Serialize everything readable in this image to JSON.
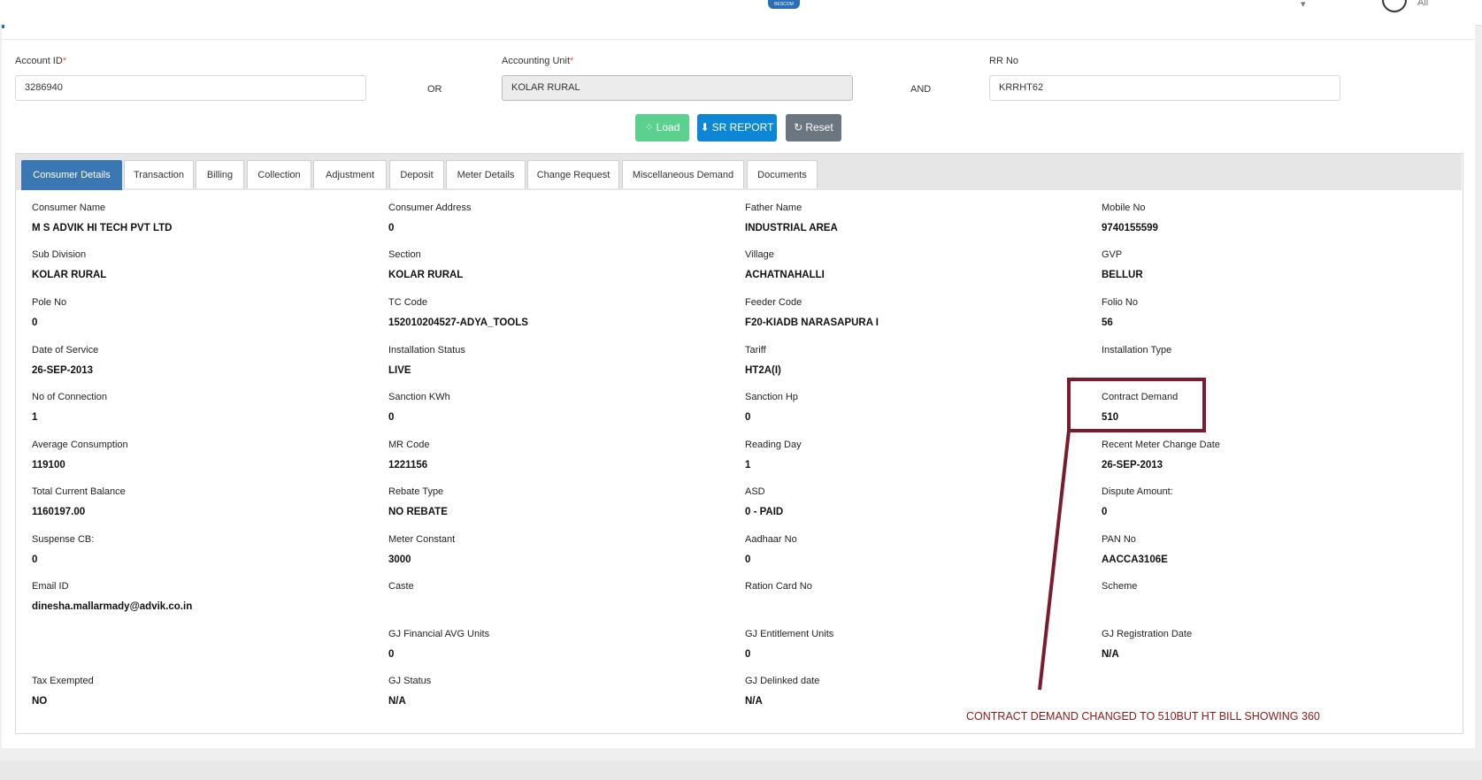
{
  "header": {
    "logo_text": "BESCOM",
    "user_menu": "▾",
    "all_label": "All"
  },
  "search": {
    "account_id": {
      "label": "Account ID",
      "required": "*",
      "value": "3286940"
    },
    "or_label": "OR",
    "accounting_unit": {
      "label": "Accounting Unit",
      "required": "*",
      "value": "KOLAR RURAL"
    },
    "and_label": "AND",
    "rr_no": {
      "label": "RR No",
      "value": "KRRHT62"
    }
  },
  "buttons": {
    "load": "Load",
    "sr_report": "SR REPORT",
    "reset": "Reset"
  },
  "tabs": [
    "Consumer Details",
    "Transaction",
    "Billing",
    "Collection",
    "Adjustment",
    "Deposit",
    "Meter Details",
    "Change Request",
    "Miscellaneous Demand",
    "Documents"
  ],
  "details": [
    {
      "label": "Consumer Name",
      "value": "M S ADVIK HI TECH PVT LTD"
    },
    {
      "label": "Consumer Address",
      "value": "0"
    },
    {
      "label": "Father Name",
      "value": "INDUSTRIAL AREA"
    },
    {
      "label": "Mobile No",
      "value": "9740155599"
    },
    {
      "label": "Sub Division",
      "value": "KOLAR RURAL"
    },
    {
      "label": "Section",
      "value": "KOLAR RURAL"
    },
    {
      "label": "Village",
      "value": "ACHATNAHALLI"
    },
    {
      "label": "GVP",
      "value": "BELLUR"
    },
    {
      "label": "Pole No",
      "value": "0"
    },
    {
      "label": "TC Code",
      "value": "152010204527-ADYA_TOOLS"
    },
    {
      "label": "Feeder Code",
      "value": "F20-KIADB NARASAPURA I"
    },
    {
      "label": "Folio No",
      "value": "56"
    },
    {
      "label": "Date of Service",
      "value": "26-SEP-2013"
    },
    {
      "label": "Installation Status",
      "value": "LIVE"
    },
    {
      "label": "Tariff",
      "value": "HT2A(I)"
    },
    {
      "label": "Installation Type",
      "value": ""
    },
    {
      "label": "No of Connection",
      "value": "1"
    },
    {
      "label": "Sanction KWh",
      "value": "0"
    },
    {
      "label": "Sanction Hp",
      "value": "0"
    },
    {
      "label": "Contract Demand",
      "value": "510"
    },
    {
      "label": "Average Consumption",
      "value": "119100"
    },
    {
      "label": "MR Code",
      "value": "1221156"
    },
    {
      "label": "Reading Day",
      "value": "1"
    },
    {
      "label": "Recent Meter Change Date",
      "value": "26-SEP-2013"
    },
    {
      "label": "Total Current Balance",
      "value": "1160197.00"
    },
    {
      "label": "Rebate Type",
      "value": "NO REBATE"
    },
    {
      "label": "ASD",
      "value": "0 - PAID"
    },
    {
      "label": "Dispute Amount:",
      "value": "0"
    },
    {
      "label": "Suspense CB:",
      "value": "0"
    },
    {
      "label": "Meter Constant",
      "value": "3000"
    },
    {
      "label": "Aadhaar No",
      "value": "0"
    },
    {
      "label": "PAN No",
      "value": "AACCA3106E"
    },
    {
      "label": "Email ID",
      "value": "dinesha.mallarmady@advik.co.in"
    },
    {
      "label": "Caste",
      "value": ""
    },
    {
      "label": "Ration Card No",
      "value": ""
    },
    {
      "label": "Scheme",
      "value": ""
    },
    {
      "label": "",
      "value": ""
    },
    {
      "label": "GJ Financial AVG Units",
      "value": "0"
    },
    {
      "label": "GJ Entitlement Units",
      "value": "0"
    },
    {
      "label": "GJ Registration Date",
      "value": "N/A"
    },
    {
      "label": "Tax Exempted",
      "value": "NO"
    },
    {
      "label": "GJ Status",
      "value": "N/A"
    },
    {
      "label": "GJ Delinked date",
      "value": "N/A"
    },
    {
      "label": "",
      "value": ""
    }
  ],
  "annotation": {
    "text": "CONTRACT DEMAND CHANGED TO 510BUT HT BILL SHOWING 360",
    "color": "#8b1a1a"
  }
}
